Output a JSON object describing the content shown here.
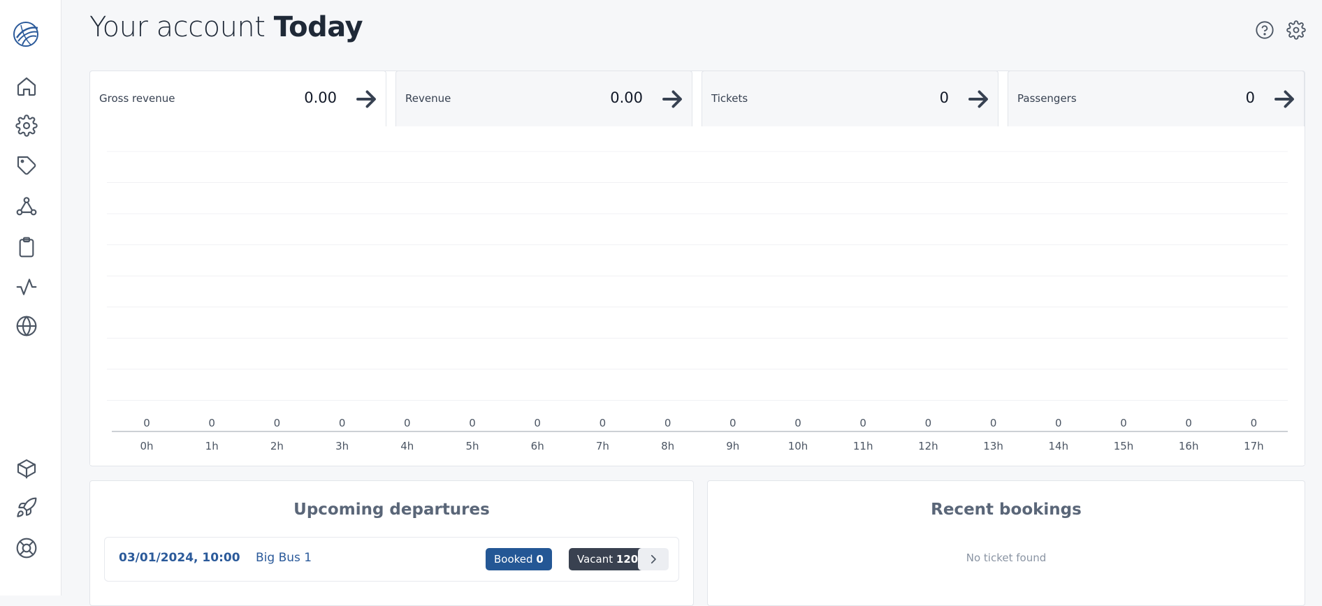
{
  "header": {
    "title_prefix": "Your account",
    "title_period": "Today"
  },
  "sidebar": {
    "items": [
      {
        "icon": "home-icon"
      },
      {
        "icon": "gear-icon"
      },
      {
        "icon": "tag-icon"
      },
      {
        "icon": "network-icon"
      },
      {
        "icon": "clipboard-icon"
      },
      {
        "icon": "activity-icon"
      },
      {
        "icon": "globe-icon"
      },
      {
        "icon": "package-icon"
      },
      {
        "icon": "rocket-icon"
      },
      {
        "icon": "lifebuoy-icon"
      }
    ]
  },
  "stats_tabs": [
    {
      "label": "Gross revenue",
      "value": "0.00"
    },
    {
      "label": "Revenue",
      "value": "0.00"
    },
    {
      "label": "Tickets",
      "value": "0"
    },
    {
      "label": "Passengers",
      "value": "0"
    }
  ],
  "chart_data": {
    "type": "bar",
    "categories": [
      "0h",
      "1h",
      "2h",
      "3h",
      "4h",
      "5h",
      "6h",
      "7h",
      "8h",
      "9h",
      "10h",
      "11h",
      "12h",
      "13h",
      "14h",
      "15h",
      "16h",
      "17h"
    ],
    "values": [
      0,
      0,
      0,
      0,
      0,
      0,
      0,
      0,
      0,
      0,
      0,
      0,
      0,
      0,
      0,
      0,
      0,
      0
    ],
    "title": "",
    "xlabel": "",
    "ylabel": "",
    "grid": true,
    "data_labels": true
  },
  "departures": {
    "title": "Upcoming departures",
    "rows": [
      {
        "date": "03/01/2024, 10:00",
        "bus": "Big Bus 1",
        "booked_label": "Booked",
        "booked": "0",
        "vacant_label": "Vacant",
        "vacant": "120"
      }
    ]
  },
  "bookings": {
    "title": "Recent bookings",
    "empty": "No ticket found"
  },
  "colors": {
    "accent": "#245795",
    "dark_badge": "#394150",
    "link": "#2b5a9a"
  }
}
